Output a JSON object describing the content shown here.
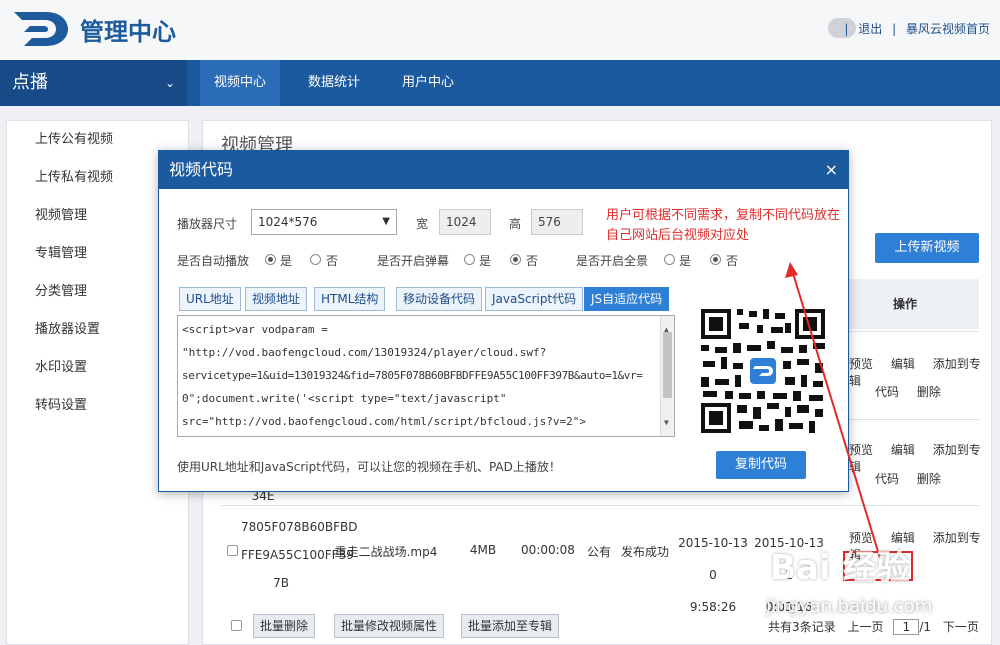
{
  "header": {
    "title": "管理中心",
    "links": [
      "|",
      "退出",
      "|",
      "暴风云视频首页"
    ]
  },
  "topnav": {
    "dropdown": "点播",
    "tabs": [
      "视频中心",
      "数据统计",
      "用户中心"
    ]
  },
  "sidebar": {
    "items": [
      "上传公有视频",
      "上传私有视频",
      "视频管理",
      "专辑管理",
      "分类管理",
      "播放器设置",
      "水印设置",
      "转码设置"
    ]
  },
  "main": {
    "title": "视频管理",
    "upload_button": "上传新视频",
    "ops_header": "操作",
    "row_ops": [
      "预览",
      "编辑",
      "添加到专辑",
      "代码",
      "删除"
    ],
    "row2_partial": "34E",
    "row3": {
      "id": [
        "7805F078B60BFBD",
        "FFE9A55C100FF39",
        "7B"
      ],
      "name": "重走二战战场.mp4",
      "size": "4MB",
      "duration": "00:00:08",
      "visibility": "公有",
      "status": "发布成功",
      "created": [
        "2015-10-13 0",
        "9:58:26"
      ],
      "updated": [
        "2015-10-13 1",
        "0:03:16"
      ]
    },
    "batch": [
      "批量删除",
      "批量修改视频属性",
      "批量添加至专辑"
    ],
    "pager": {
      "total": "共有3条记录",
      "prev": "上一页",
      "page": "1",
      "of": "/1",
      "next": "下一页"
    }
  },
  "modal": {
    "title": "视频代码",
    "close": "×",
    "player_size_label": "播放器尺寸",
    "player_size_value": "1024*576",
    "width_label": "宽",
    "width_value": "1024",
    "height_label": "高",
    "height_value": "576",
    "autoplay_label": "是否自动播放",
    "barrage_label": "是否开启弹幕",
    "fullscreen_label": "是否开启全景",
    "yes": "是",
    "no": "否",
    "note": "用户可根据不同需求，复制不同代码放在自己网站后台视频对应处",
    "tabs": [
      "URL地址",
      "视频地址",
      "HTML结构",
      "移动设备代码",
      "JavaScript代码",
      "JS自适应代码"
    ],
    "code_lines": [
      "<script>var vodparam =",
      "\"http://vod.baofengcloud.com/13019324/player/cloud.swf?",
      "servicetype=1&uid=13019324&fid=7805F078B60BFBDFFE9A55C100FF397B&auto=1&vr=",
      "0\";document.write('<script type=\"text/javascript\"",
      "src=\"http://vod.baofengcloud.com/html/script/bfcloud.js?v=2\">"
    ],
    "copy_button": "复制代码",
    "footer": "使用URL地址和JavaScript代码，可以让您的视频在手机、PAD上播放！"
  },
  "watermark": {
    "brand": "Bai 经验",
    "url": "jingyan.baidu.com"
  },
  "colors": {
    "primary": "#1c5aa0",
    "button": "#2e7fd6",
    "note": "#e02b2b"
  }
}
